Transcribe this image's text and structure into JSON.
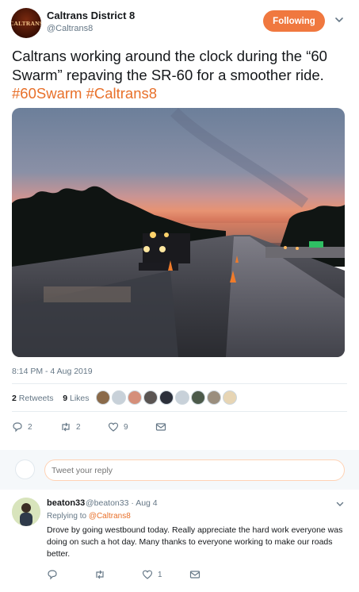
{
  "tweet": {
    "display_name": "Caltrans District 8",
    "handle": "@Caltrans8",
    "avatar_logo_text": "CALTRANS",
    "follow_label": "Following",
    "text_parts": [
      "Caltrans working around the clock during the “60 Swarm” repaving the SR-60 for a smoother ride. ",
      "#60Swarm",
      " ",
      "#Caltrans8"
    ],
    "timestamp": "8:14 PM - 4 Aug 2019",
    "stats": {
      "retweets_count": "2",
      "retweets_label": "Retweets",
      "likes_count": "9",
      "likes_label": "Likes"
    },
    "actions": {
      "reply_count": "2",
      "retweet_count": "2",
      "like_count": "9"
    }
  },
  "reply_box": {
    "placeholder": "Tweet your reply"
  },
  "reply": {
    "display_name": "beaton33",
    "meta": "@beaton33 · Aug 4",
    "replying_to_label": "Replying to ",
    "replying_to_handle": "@Caltrans8",
    "text": "Drove by going westbound today.  Really appreciate the hard work everyone was doing on such a hot day.  Many thanks to everyone working to make our roads better.",
    "like_count": "1"
  },
  "colors": {
    "accent": "#e8702a",
    "follow_button": "#f0783f",
    "secondary_text": "#657786"
  },
  "icons": [
    "chevron-down-icon",
    "reply-icon",
    "retweet-icon",
    "like-icon",
    "message-icon"
  ]
}
